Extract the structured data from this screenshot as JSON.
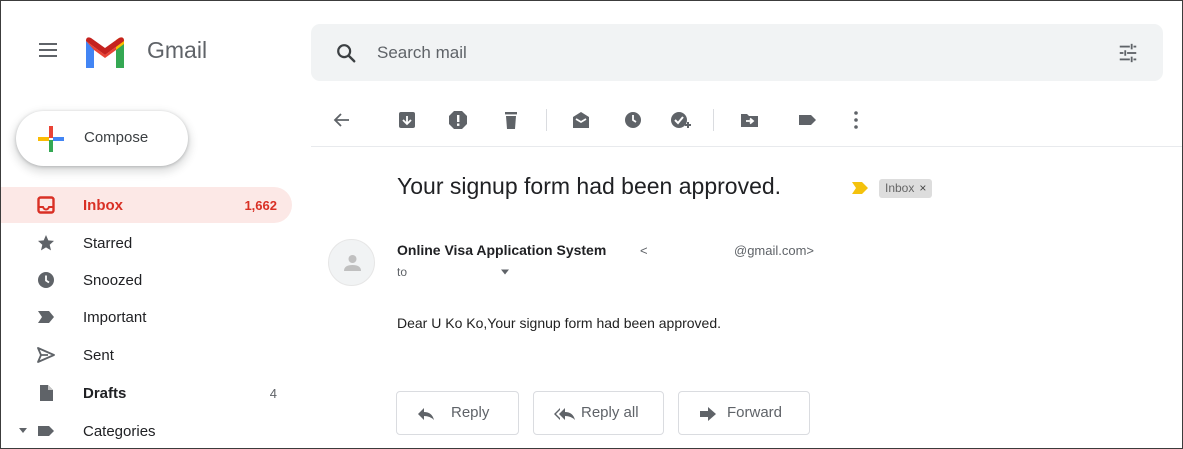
{
  "app": {
    "brand": "Gmail"
  },
  "search": {
    "placeholder": "Search mail"
  },
  "compose": {
    "label": "Compose"
  },
  "sidebar": {
    "items": [
      {
        "label": "Inbox",
        "count": "1,662"
      },
      {
        "label": "Starred",
        "count": ""
      },
      {
        "label": "Snoozed",
        "count": ""
      },
      {
        "label": "Important",
        "count": ""
      },
      {
        "label": "Sent",
        "count": ""
      },
      {
        "label": "Drafts",
        "count": "4"
      },
      {
        "label": "Categories",
        "count": ""
      }
    ]
  },
  "message": {
    "subject": "Your signup form had been approved.",
    "label_chip": "Inbox",
    "label_chip_close": "×",
    "sender_name": "Online Visa Application System",
    "sender_email_open": "<",
    "sender_email": "@gmail.com>",
    "to": "to",
    "body": "Dear U Ko Ko,Your signup form had been approved."
  },
  "actions": {
    "reply": "Reply",
    "reply_all": "Reply all",
    "forward": "Forward"
  },
  "colors": {
    "accent_red": "#d93025",
    "active_bg": "#fce8e6",
    "importance_yellow": "#f4c20d",
    "icon_gray": "#5f6368"
  },
  "icons": {
    "toolbar": [
      "back-arrow-icon",
      "archive-icon",
      "report-spam-icon",
      "delete-icon",
      "mark-unread-icon",
      "snooze-icon",
      "add-to-tasks-icon",
      "move-to-icon",
      "labels-icon",
      "more-options-icon"
    ]
  }
}
